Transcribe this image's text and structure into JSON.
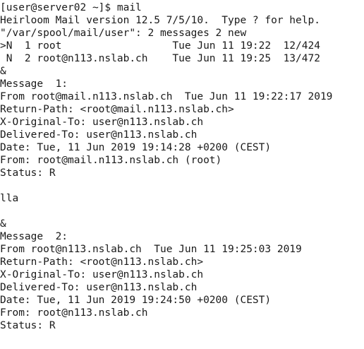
{
  "terminal": {
    "lines": [
      "[user@server02 ~]$ mail",
      "Heirloom Mail version 12.5 7/5/10.  Type ? for help.",
      "\"/var/spool/mail/user\": 2 messages 2 new",
      ">N  1 root                  Tue Jun 11 19:22  12/424",
      " N  2 root@n113.nslab.ch    Tue Jun 11 19:25  13/472",
      "&",
      "Message  1:",
      "From root@mail.n113.nslab.ch  Tue Jun 11 19:22:17 2019",
      "Return-Path: <root@mail.n113.nslab.ch>",
      "X-Original-To: user@n113.nslab.ch",
      "Delivered-To: user@n113.nslab.ch",
      "Date: Tue, 11 Jun 2019 19:14:28 +0200 (CEST)",
      "From: root@mail.n113.nslab.ch (root)",
      "Status: R",
      "",
      "lla",
      "",
      "&",
      "Message  2:",
      "From root@n113.nslab.ch  Tue Jun 11 19:25:03 2019",
      "Return-Path: <root@n113.nslab.ch>",
      "X-Original-To: user@n113.nslab.ch",
      "Delivered-To: user@n113.nslab.ch",
      "Date: Tue, 11 Jun 2019 19:24:50 +0200 (CEST)",
      "From: root@n113.nslab.ch",
      "Status: R"
    ]
  }
}
